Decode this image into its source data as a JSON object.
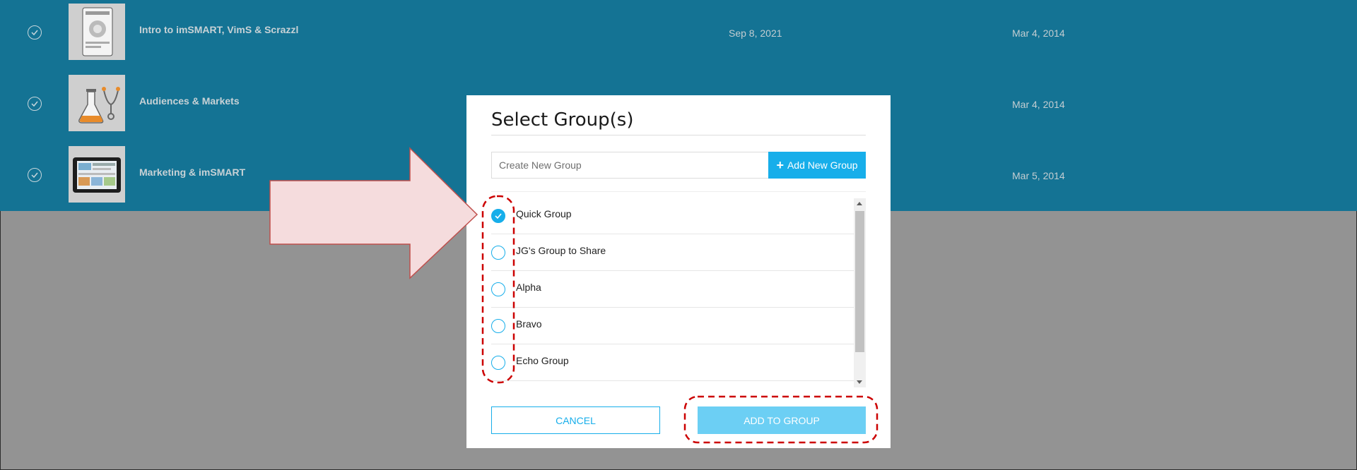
{
  "background_rows": [
    {
      "title": "Intro to imSMART, VimS & Scrazzl",
      "date_1": "Sep 8, 2021",
      "date_2": "Mar 4, 2014",
      "thumbnail": "flyer-thumbnail"
    },
    {
      "title": "Audiences & Markets",
      "date_1": "",
      "date_2": "Mar 4, 2014",
      "thumbnail": "lab-flask-thumbnail"
    },
    {
      "title": "Marketing & imSMART",
      "date_1": "",
      "date_2": "Mar 5, 2014",
      "thumbnail": "tablet-thumbnail"
    }
  ],
  "modal": {
    "title": "Select Group(s)",
    "new_group_placeholder": "Create New Group",
    "add_new_group_label": "Add New Group",
    "groups": [
      {
        "label": "Quick Group",
        "checked": true
      },
      {
        "label": "JG's Group to Share",
        "checked": false
      },
      {
        "label": "Alpha",
        "checked": false
      },
      {
        "label": "Bravo",
        "checked": false
      },
      {
        "label": "Echo Group",
        "checked": false
      }
    ],
    "cancel_label": "CANCEL",
    "add_to_group_label": "ADD TO GROUP"
  },
  "colors": {
    "row_background": "#147394",
    "accent": "#17aeea",
    "add_to_group_button": "#6ccff4",
    "annotation_red": "#cc0000",
    "annotation_arrow_fill": "#f5dcdd",
    "backdrop": "#939393"
  }
}
